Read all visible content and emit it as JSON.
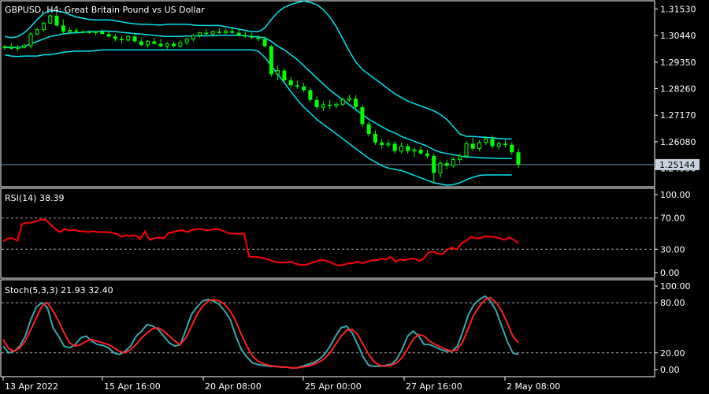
{
  "chart_data": [
    {
      "type": "candlestick",
      "title": "GBPUSD, H4:  Great Britain Pound vs US Dollar",
      "y_ticks": [
        "1.31530",
        "1.30440",
        "1.29350",
        "1.28260",
        "1.27170",
        "1.26080",
        "1.24990"
      ],
      "ylim": [
        1.243,
        1.318
      ],
      "current_price": "1.25144",
      "x_ticks": [
        "13 Apr 2022",
        "15 Apr 16:00",
        "20 Apr 08:00",
        "25 Apr 00:00",
        "27 Apr 16:00",
        "2 May 08:00"
      ],
      "candles": [
        [
          1.2995,
          1.3005,
          1.2985,
          1.2998
        ],
        [
          1.2998,
          1.3012,
          1.2985,
          1.299
        ],
        [
          1.299,
          1.3005,
          1.298,
          1.2995
        ],
        [
          1.2995,
          1.301,
          1.299,
          1.3002
        ],
        [
          1.3002,
          1.306,
          1.299,
          1.305
        ],
        [
          1.305,
          1.3075,
          1.3045,
          1.3068
        ],
        [
          1.3068,
          1.31,
          1.306,
          1.3095
        ],
        [
          1.3095,
          1.313,
          1.309,
          1.3125
        ],
        [
          1.3125,
          1.3135,
          1.308,
          1.3085
        ],
        [
          1.3085,
          1.311,
          1.305,
          1.306
        ],
        [
          1.306,
          1.3075,
          1.305,
          1.3065
        ],
        [
          1.3065,
          1.3075,
          1.3055,
          1.306
        ],
        [
          1.306,
          1.3068,
          1.3052,
          1.3058
        ],
        [
          1.3058,
          1.3066,
          1.305,
          1.3055
        ],
        [
          1.3055,
          1.3065,
          1.3045,
          1.306
        ],
        [
          1.306,
          1.307,
          1.305,
          1.305
        ],
        [
          1.305,
          1.306,
          1.3035,
          1.304
        ],
        [
          1.304,
          1.305,
          1.302,
          1.303
        ],
        [
          1.303,
          1.304,
          1.301,
          1.3025
        ],
        [
          1.3025,
          1.3045,
          1.302,
          1.304
        ],
        [
          1.304,
          1.305,
          1.3015,
          1.302
        ],
        [
          1.302,
          1.303,
          1.3,
          1.3005
        ],
        [
          1.3005,
          1.3025,
          1.2995,
          1.302
        ],
        [
          1.302,
          1.3035,
          1.3005,
          1.301
        ],
        [
          1.301,
          1.303,
          1.2995,
          1.3
        ],
        [
          1.3,
          1.3015,
          1.299,
          1.301
        ],
        [
          1.301,
          1.302,
          1.2995,
          1.3
        ],
        [
          1.3,
          1.3025,
          1.2995,
          1.3015
        ],
        [
          1.3015,
          1.3035,
          1.3005,
          1.303
        ],
        [
          1.303,
          1.305,
          1.302,
          1.3045
        ],
        [
          1.3045,
          1.306,
          1.3035,
          1.3055
        ],
        [
          1.3055,
          1.307,
          1.3045,
          1.305
        ],
        [
          1.305,
          1.3065,
          1.304,
          1.306
        ],
        [
          1.306,
          1.3075,
          1.305,
          1.3055
        ],
        [
          1.3055,
          1.307,
          1.3045,
          1.3062
        ],
        [
          1.3062,
          1.308,
          1.305,
          1.3055
        ],
        [
          1.3055,
          1.307,
          1.304,
          1.3045
        ],
        [
          1.3045,
          1.306,
          1.3035,
          1.304
        ],
        [
          1.304,
          1.3055,
          1.303,
          1.3035
        ],
        [
          1.3035,
          1.3045,
          1.302,
          1.303
        ],
        [
          1.303,
          1.304,
          1.2995,
          1.3
        ],
        [
          1.3,
          1.3005,
          1.2875,
          1.2885
        ],
        [
          1.2885,
          1.292,
          1.286,
          1.29
        ],
        [
          1.29,
          1.291,
          1.285,
          1.286
        ],
        [
          1.286,
          1.2875,
          1.283,
          1.284
        ],
        [
          1.284,
          1.286,
          1.2825,
          1.2835
        ],
        [
          1.2835,
          1.285,
          1.281,
          1.282
        ],
        [
          1.282,
          1.283,
          1.277,
          1.278
        ],
        [
          1.278,
          1.2795,
          1.274,
          1.275
        ],
        [
          1.275,
          1.2775,
          1.2735,
          1.276
        ],
        [
          1.276,
          1.278,
          1.274,
          1.2755
        ],
        [
          1.2755,
          1.277,
          1.2745,
          1.2762
        ],
        [
          1.2762,
          1.279,
          1.2755,
          1.278
        ],
        [
          1.278,
          1.28,
          1.277,
          1.2785
        ],
        [
          1.2785,
          1.28,
          1.274,
          1.275
        ],
        [
          1.275,
          1.276,
          1.267,
          1.268
        ],
        [
          1.268,
          1.269,
          1.263,
          1.264
        ],
        [
          1.264,
          1.2655,
          1.2595,
          1.2605
        ],
        [
          1.2605,
          1.262,
          1.258,
          1.2595
        ],
        [
          1.2595,
          1.2615,
          1.2585,
          1.26
        ],
        [
          1.26,
          1.261,
          1.256,
          1.257
        ],
        [
          1.257,
          1.2605,
          1.256,
          1.259
        ],
        [
          1.259,
          1.26,
          1.256,
          1.257
        ],
        [
          1.257,
          1.2585,
          1.2545,
          1.2575
        ],
        [
          1.2575,
          1.259,
          1.2555,
          1.256
        ],
        [
          1.256,
          1.2575,
          1.254,
          1.255
        ],
        [
          1.255,
          1.256,
          1.244,
          1.248
        ],
        [
          1.248,
          1.253,
          1.246,
          1.252
        ],
        [
          1.252,
          1.2535,
          1.2495,
          1.251
        ],
        [
          1.251,
          1.2545,
          1.25,
          1.2535
        ],
        [
          1.2535,
          1.256,
          1.252,
          1.255
        ],
        [
          1.255,
          1.261,
          1.2545,
          1.26
        ],
        [
          1.26,
          1.2625,
          1.257,
          1.258
        ],
        [
          1.258,
          1.2615,
          1.257,
          1.2605
        ],
        [
          1.2605,
          1.263,
          1.2595,
          1.262
        ],
        [
          1.262,
          1.2635,
          1.258,
          1.259
        ],
        [
          1.259,
          1.261,
          1.2575,
          1.26
        ],
        [
          1.26,
          1.2615,
          1.2585,
          1.2595
        ],
        [
          1.2595,
          1.2605,
          1.2555,
          1.2565
        ],
        [
          1.2565,
          1.258,
          1.25,
          1.2514
        ]
      ],
      "bollinger": {
        "upper": [
          1.304,
          1.3035,
          1.304,
          1.3055,
          1.308,
          1.311,
          1.3135,
          1.3145,
          1.3145,
          1.314,
          1.313,
          1.312,
          1.3115,
          1.311,
          1.3108,
          1.3108,
          1.3108,
          1.3105,
          1.31,
          1.3095,
          1.3092,
          1.309,
          1.309,
          1.3088,
          1.3087,
          1.309,
          1.309,
          1.309,
          1.309,
          1.3087,
          1.3085,
          1.3085,
          1.3085,
          1.3085,
          1.308,
          1.3075,
          1.307,
          1.3065,
          1.306,
          1.306,
          1.3075,
          1.311,
          1.314,
          1.316,
          1.317,
          1.318,
          1.3185,
          1.318,
          1.317,
          1.315,
          1.312,
          1.308,
          1.303,
          1.298,
          1.2935,
          1.2905,
          1.2885,
          1.2865,
          1.2845,
          1.2825,
          1.2805,
          1.279,
          1.2775,
          1.2765,
          1.2755,
          1.2745,
          1.2735,
          1.272,
          1.27,
          1.267,
          1.264,
          1.263,
          1.263,
          1.2628,
          1.2626,
          1.2624,
          1.2622,
          1.262,
          1.262
        ],
        "middle": [
          1.2995,
          1.2995,
          1.2995,
          1.3,
          1.301,
          1.302,
          1.303,
          1.304,
          1.3045,
          1.305,
          1.3055,
          1.3055,
          1.3057,
          1.306,
          1.306,
          1.3062,
          1.3062,
          1.306,
          1.3057,
          1.3055,
          1.3052,
          1.305,
          1.3047,
          1.3045,
          1.3042,
          1.304,
          1.304,
          1.304,
          1.3042,
          1.3042,
          1.3043,
          1.3043,
          1.3043,
          1.3045,
          1.3045,
          1.3045,
          1.3045,
          1.3043,
          1.304,
          1.3038,
          1.3035,
          1.302,
          1.3,
          1.2985,
          1.2965,
          1.2945,
          1.292,
          1.2895,
          1.287,
          1.2845,
          1.282,
          1.28,
          1.278,
          1.276,
          1.274,
          1.272,
          1.27,
          1.2685,
          1.267,
          1.2655,
          1.2645,
          1.263,
          1.262,
          1.261,
          1.26,
          1.259,
          1.2575,
          1.2565,
          1.256,
          1.2555,
          1.255,
          1.2545,
          1.2545,
          1.2543,
          1.2542,
          1.2541,
          1.254,
          1.254,
          1.254
        ],
        "lower": [
          1.2965,
          1.296,
          1.2958,
          1.296,
          1.296,
          1.296,
          1.2965,
          1.2965,
          1.297,
          1.2975,
          1.2978,
          1.298,
          1.298,
          1.298,
          1.2982,
          1.2985,
          1.2985,
          1.2985,
          1.2985,
          1.2985,
          1.2985,
          1.2985,
          1.2985,
          1.2985,
          1.2985,
          1.2985,
          1.2985,
          1.2985,
          1.2985,
          1.2985,
          1.2985,
          1.2985,
          1.2985,
          1.2985,
          1.2985,
          1.2985,
          1.2985,
          1.2985,
          1.2985,
          1.298,
          1.2955,
          1.292,
          1.2885,
          1.285,
          1.2815,
          1.278,
          1.275,
          1.2725,
          1.27,
          1.268,
          1.266,
          1.264,
          1.262,
          1.26,
          1.258,
          1.256,
          1.254,
          1.2525,
          1.251,
          1.25,
          1.2495,
          1.249,
          1.248,
          1.247,
          1.246,
          1.245,
          1.244,
          1.2435,
          1.243,
          1.2432,
          1.244,
          1.2452,
          1.2462,
          1.247,
          1.2472,
          1.2472,
          1.2472,
          1.2472,
          1.2472
        ]
      }
    },
    {
      "type": "line",
      "title": "RSI(14) 38.39",
      "y_ticks": [
        "100.00",
        "70.00",
        "30.00",
        "0.00"
      ],
      "ylim": [
        0,
        100
      ],
      "levels": [
        70,
        30
      ],
      "series": [
        {
          "color": "#ff0000",
          "values": [
            40,
            44,
            44,
            41,
            62,
            64,
            64,
            66,
            68,
            68,
            62,
            56,
            52,
            56,
            54,
            55,
            53,
            53,
            52,
            53,
            52,
            52,
            52,
            51,
            50,
            46,
            48,
            47,
            48,
            43,
            53,
            42,
            44,
            45,
            44,
            51,
            52,
            54,
            54,
            52,
            55,
            56,
            56,
            54,
            55,
            56,
            55,
            52,
            50,
            50,
            50,
            50,
            21,
            20,
            20,
            19,
            17,
            15,
            13,
            13,
            13,
            14,
            11,
            10,
            10,
            12,
            14,
            16,
            16,
            14,
            11,
            9,
            10,
            12,
            12,
            14,
            12,
            14,
            16,
            16,
            18,
            17,
            20,
            14,
            17,
            16,
            18,
            18,
            15,
            18,
            26,
            27,
            24,
            24,
            30,
            32,
            30,
            38,
            41,
            46,
            44,
            44,
            47,
            46,
            46,
            44,
            42,
            45,
            42,
            38
          ]
        }
      ]
    },
    {
      "type": "line",
      "title": "Stoch(5,3,3) 21.93 32.40",
      "y_ticks": [
        "100.00",
        "80.00",
        "20.00",
        "0.00"
      ],
      "ylim": [
        0,
        100
      ],
      "levels": [
        80,
        20
      ],
      "series": [
        {
          "color": "#3aa8b0",
          "values": [
            28,
            20,
            22,
            28,
            40,
            60,
            75,
            80,
            74,
            50,
            40,
            28,
            26,
            30,
            38,
            40,
            34,
            30,
            29,
            26,
            20,
            18,
            22,
            28,
            40,
            46,
            54,
            52,
            48,
            40,
            32,
            28,
            30,
            48,
            66,
            75,
            82,
            84,
            82,
            78,
            70,
            60,
            40,
            24,
            15,
            8,
            6,
            5,
            4,
            4,
            3,
            3,
            2,
            2,
            4,
            6,
            8,
            12,
            18,
            28,
            40,
            50,
            52,
            44,
            30,
            15,
            5,
            4,
            4,
            5,
            6,
            12,
            24,
            40,
            46,
            40,
            30,
            30,
            27,
            24,
            22,
            22,
            28,
            46,
            66,
            78,
            84,
            88,
            82,
            70,
            52,
            34,
            20,
            18
          ]
        },
        {
          "color": "#ff2020",
          "values": [
            36,
            25,
            22,
            26,
            34,
            48,
            62,
            76,
            80,
            70,
            58,
            44,
            32,
            28,
            30,
            34,
            36,
            34,
            32,
            30,
            26,
            22,
            20,
            24,
            30,
            38,
            44,
            49,
            50,
            46,
            40,
            34,
            30,
            38,
            52,
            66,
            76,
            82,
            84,
            82,
            78,
            70,
            58,
            42,
            28,
            16,
            10,
            7,
            5,
            4,
            3,
            3,
            2,
            2,
            3,
            4,
            6,
            9,
            13,
            20,
            30,
            40,
            47,
            48,
            42,
            30,
            18,
            9,
            5,
            4,
            5,
            8,
            14,
            25,
            36,
            42,
            40,
            34,
            30,
            27,
            24,
            22,
            24,
            34,
            50,
            66,
            76,
            84,
            86,
            80,
            70,
            56,
            40,
            32
          ]
        }
      ]
    }
  ],
  "colors": {
    "background": "#000000",
    "axes": "#ffffff",
    "candle": "#00ff00",
    "bollinger": "#00e5ee",
    "price_line": "#6f8fae",
    "rsi": "#ff0000",
    "stoch_main": "#3aa8b0",
    "stoch_signal": "#ff2020",
    "level_line": "#aaaaaa"
  }
}
